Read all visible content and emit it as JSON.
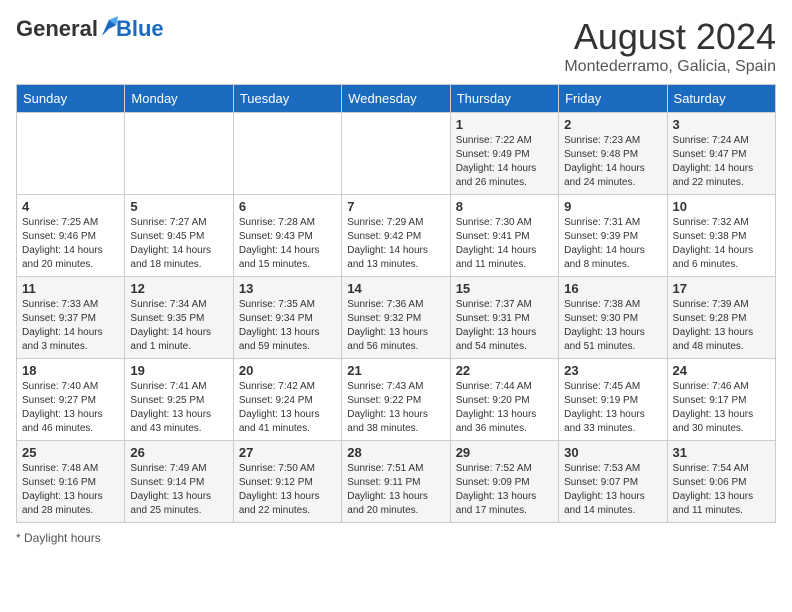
{
  "header": {
    "logo_general": "General",
    "logo_blue": "Blue",
    "main_title": "August 2024",
    "subtitle": "Montederramo, Galicia, Spain"
  },
  "calendar": {
    "days_of_week": [
      "Sunday",
      "Monday",
      "Tuesday",
      "Wednesday",
      "Thursday",
      "Friday",
      "Saturday"
    ],
    "weeks": [
      [
        {
          "day": "",
          "info": ""
        },
        {
          "day": "",
          "info": ""
        },
        {
          "day": "",
          "info": ""
        },
        {
          "day": "",
          "info": ""
        },
        {
          "day": "1",
          "info": "Sunrise: 7:22 AM\nSunset: 9:49 PM\nDaylight: 14 hours and 26 minutes."
        },
        {
          "day": "2",
          "info": "Sunrise: 7:23 AM\nSunset: 9:48 PM\nDaylight: 14 hours and 24 minutes."
        },
        {
          "day": "3",
          "info": "Sunrise: 7:24 AM\nSunset: 9:47 PM\nDaylight: 14 hours and 22 minutes."
        }
      ],
      [
        {
          "day": "4",
          "info": "Sunrise: 7:25 AM\nSunset: 9:46 PM\nDaylight: 14 hours and 20 minutes."
        },
        {
          "day": "5",
          "info": "Sunrise: 7:27 AM\nSunset: 9:45 PM\nDaylight: 14 hours and 18 minutes."
        },
        {
          "day": "6",
          "info": "Sunrise: 7:28 AM\nSunset: 9:43 PM\nDaylight: 14 hours and 15 minutes."
        },
        {
          "day": "7",
          "info": "Sunrise: 7:29 AM\nSunset: 9:42 PM\nDaylight: 14 hours and 13 minutes."
        },
        {
          "day": "8",
          "info": "Sunrise: 7:30 AM\nSunset: 9:41 PM\nDaylight: 14 hours and 11 minutes."
        },
        {
          "day": "9",
          "info": "Sunrise: 7:31 AM\nSunset: 9:39 PM\nDaylight: 14 hours and 8 minutes."
        },
        {
          "day": "10",
          "info": "Sunrise: 7:32 AM\nSunset: 9:38 PM\nDaylight: 14 hours and 6 minutes."
        }
      ],
      [
        {
          "day": "11",
          "info": "Sunrise: 7:33 AM\nSunset: 9:37 PM\nDaylight: 14 hours and 3 minutes."
        },
        {
          "day": "12",
          "info": "Sunrise: 7:34 AM\nSunset: 9:35 PM\nDaylight: 14 hours and 1 minute."
        },
        {
          "day": "13",
          "info": "Sunrise: 7:35 AM\nSunset: 9:34 PM\nDaylight: 13 hours and 59 minutes."
        },
        {
          "day": "14",
          "info": "Sunrise: 7:36 AM\nSunset: 9:32 PM\nDaylight: 13 hours and 56 minutes."
        },
        {
          "day": "15",
          "info": "Sunrise: 7:37 AM\nSunset: 9:31 PM\nDaylight: 13 hours and 54 minutes."
        },
        {
          "day": "16",
          "info": "Sunrise: 7:38 AM\nSunset: 9:30 PM\nDaylight: 13 hours and 51 minutes."
        },
        {
          "day": "17",
          "info": "Sunrise: 7:39 AM\nSunset: 9:28 PM\nDaylight: 13 hours and 48 minutes."
        }
      ],
      [
        {
          "day": "18",
          "info": "Sunrise: 7:40 AM\nSunset: 9:27 PM\nDaylight: 13 hours and 46 minutes."
        },
        {
          "day": "19",
          "info": "Sunrise: 7:41 AM\nSunset: 9:25 PM\nDaylight: 13 hours and 43 minutes."
        },
        {
          "day": "20",
          "info": "Sunrise: 7:42 AM\nSunset: 9:24 PM\nDaylight: 13 hours and 41 minutes."
        },
        {
          "day": "21",
          "info": "Sunrise: 7:43 AM\nSunset: 9:22 PM\nDaylight: 13 hours and 38 minutes."
        },
        {
          "day": "22",
          "info": "Sunrise: 7:44 AM\nSunset: 9:20 PM\nDaylight: 13 hours and 36 minutes."
        },
        {
          "day": "23",
          "info": "Sunrise: 7:45 AM\nSunset: 9:19 PM\nDaylight: 13 hours and 33 minutes."
        },
        {
          "day": "24",
          "info": "Sunrise: 7:46 AM\nSunset: 9:17 PM\nDaylight: 13 hours and 30 minutes."
        }
      ],
      [
        {
          "day": "25",
          "info": "Sunrise: 7:48 AM\nSunset: 9:16 PM\nDaylight: 13 hours and 28 minutes."
        },
        {
          "day": "26",
          "info": "Sunrise: 7:49 AM\nSunset: 9:14 PM\nDaylight: 13 hours and 25 minutes."
        },
        {
          "day": "27",
          "info": "Sunrise: 7:50 AM\nSunset: 9:12 PM\nDaylight: 13 hours and 22 minutes."
        },
        {
          "day": "28",
          "info": "Sunrise: 7:51 AM\nSunset: 9:11 PM\nDaylight: 13 hours and 20 minutes."
        },
        {
          "day": "29",
          "info": "Sunrise: 7:52 AM\nSunset: 9:09 PM\nDaylight: 13 hours and 17 minutes."
        },
        {
          "day": "30",
          "info": "Sunrise: 7:53 AM\nSunset: 9:07 PM\nDaylight: 13 hours and 14 minutes."
        },
        {
          "day": "31",
          "info": "Sunrise: 7:54 AM\nSunset: 9:06 PM\nDaylight: 13 hours and 11 minutes."
        }
      ]
    ]
  },
  "footer": {
    "note": "Daylight hours"
  }
}
